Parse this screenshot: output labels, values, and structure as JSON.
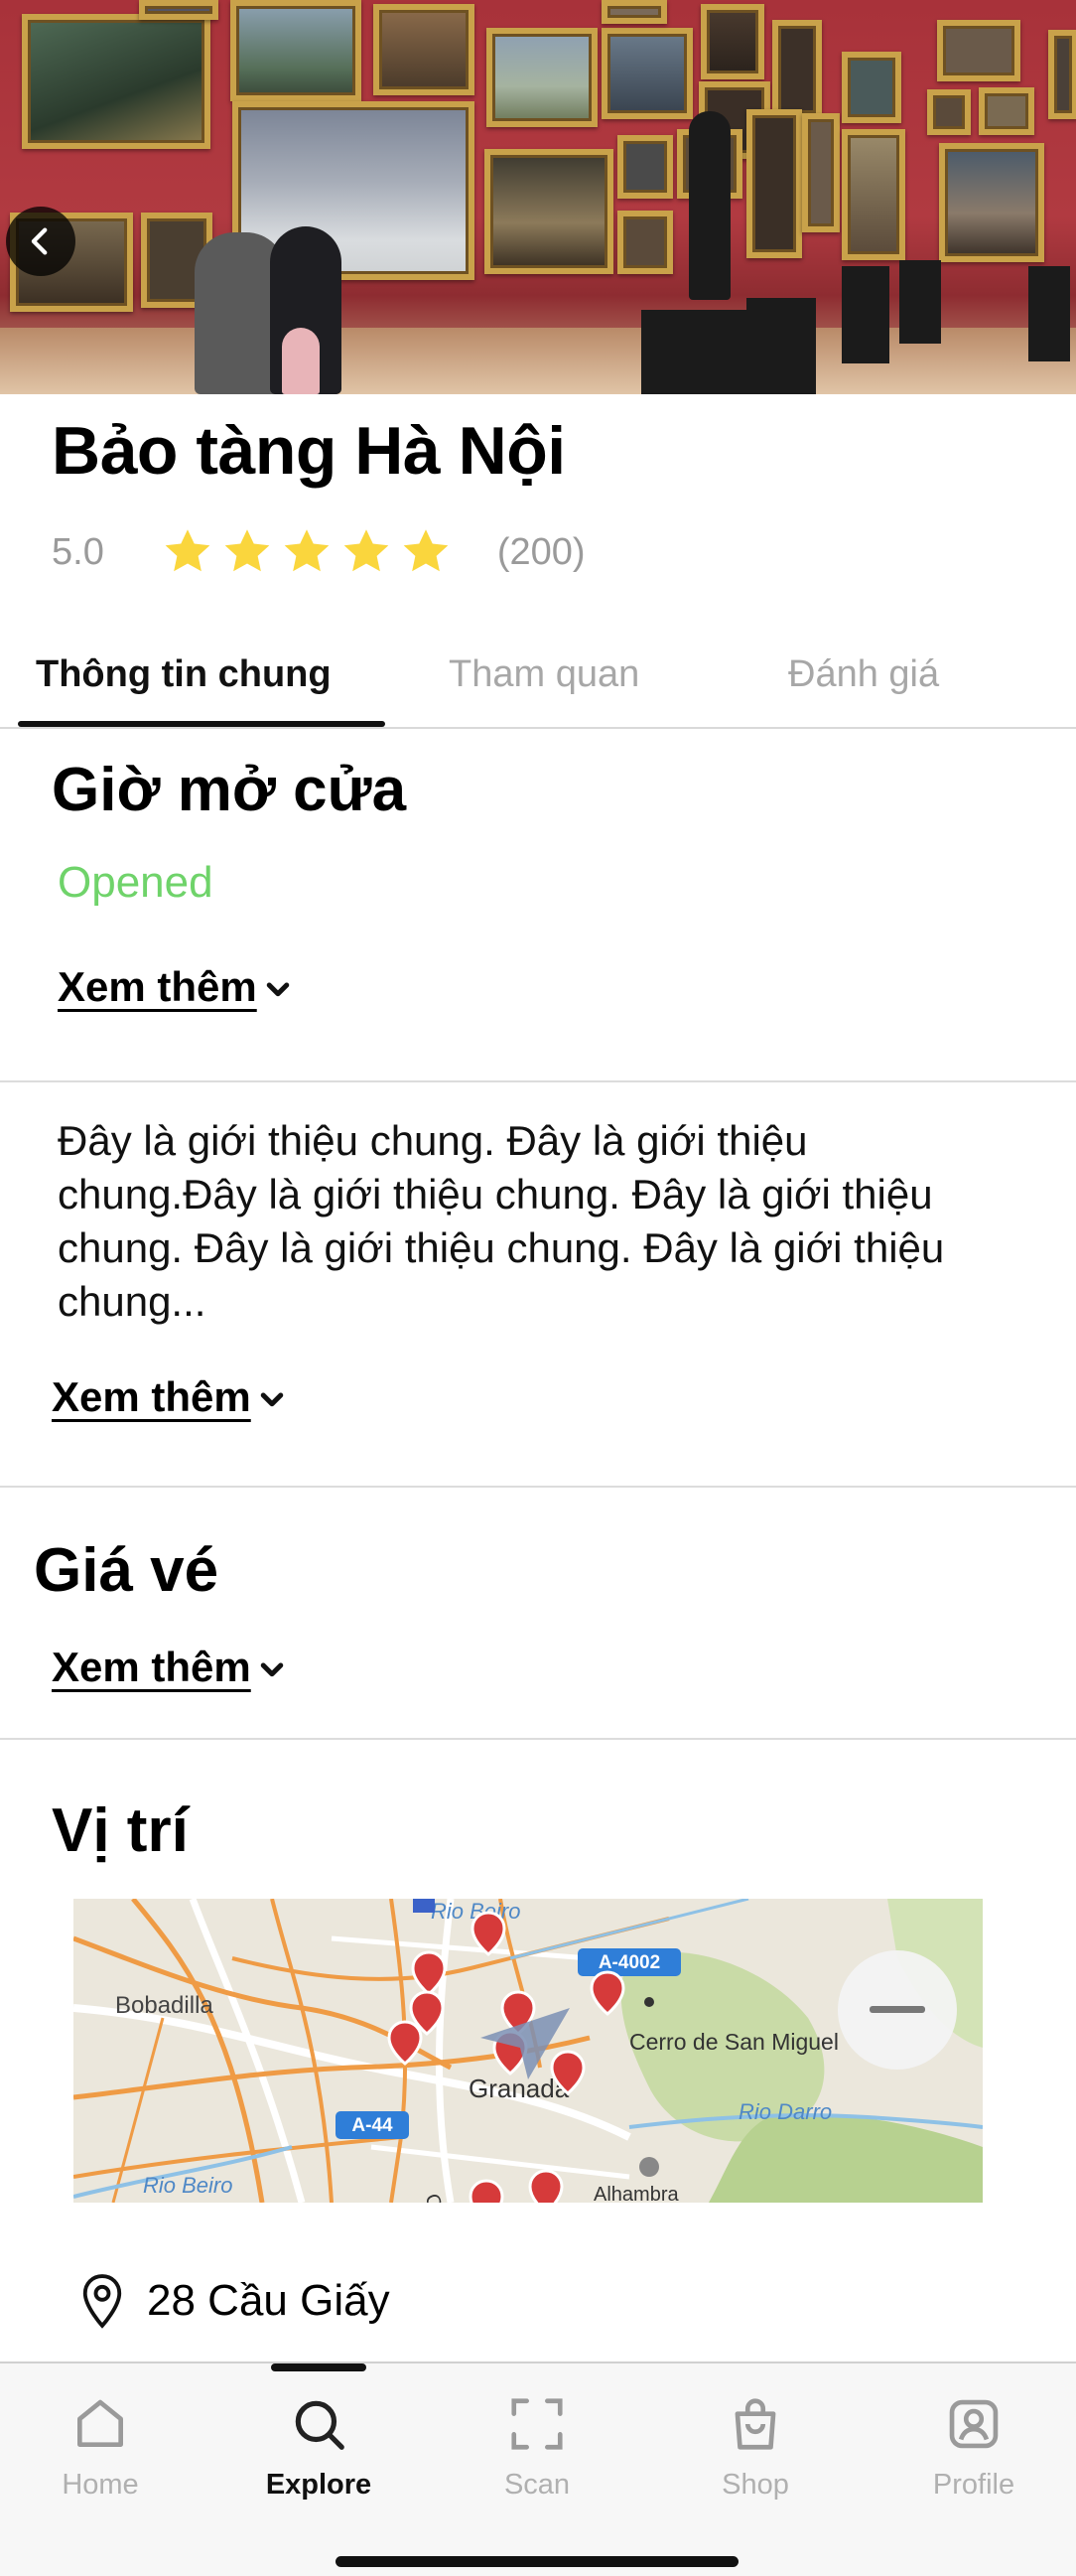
{
  "place": {
    "title": "Bảo tàng Hà Nội",
    "rating_score": "5.0",
    "rating_stars": 5,
    "rating_count": "(200)"
  },
  "tabs": [
    {
      "label": "Thông tin chung",
      "active": true
    },
    {
      "label": "Tham quan",
      "active": false
    },
    {
      "label": "Đánh giá",
      "active": false
    }
  ],
  "hours": {
    "heading": "Giờ mở cửa",
    "status": "Opened",
    "more_label": "Xem thêm"
  },
  "intro": {
    "text": "Đây là giới thiệu chung. Đây là giới thiệu chung.Đây là giới thiệu chung. Đây là giới thiệu chung. Đây là giới thiệu chung. Đây là giới thiệu chung...",
    "more_label": "Xem thêm"
  },
  "tickets": {
    "heading": "Giá vé",
    "more_label": "Xem thêm"
  },
  "location": {
    "heading": "Vị trí",
    "address": "28 Cầu Giấy",
    "map_labels": {
      "town1": "Bobadilla",
      "city": "Granada",
      "hill": "Cerro de San Miguel",
      "river1": "Rio Beiro",
      "river2": "Rio Darro",
      "road1": "A-4002",
      "road2": "A-44",
      "street": "Calle",
      "landmark": "Alhambra"
    }
  },
  "nav": [
    {
      "label": "Home",
      "icon": "home-icon",
      "active": false
    },
    {
      "label": "Explore",
      "icon": "search-icon",
      "active": true
    },
    {
      "label": "Scan",
      "icon": "scan-icon",
      "active": false
    },
    {
      "label": "Shop",
      "icon": "shopping-bag-icon",
      "active": false
    },
    {
      "label": "Profile",
      "icon": "profile-icon",
      "active": false
    }
  ],
  "colors": {
    "accent_status": "#6fd36a",
    "star": "#fad63d",
    "muted": "#9a9a9a",
    "museum_wall": "#a8323a",
    "map_pin": "#d63a3a"
  }
}
